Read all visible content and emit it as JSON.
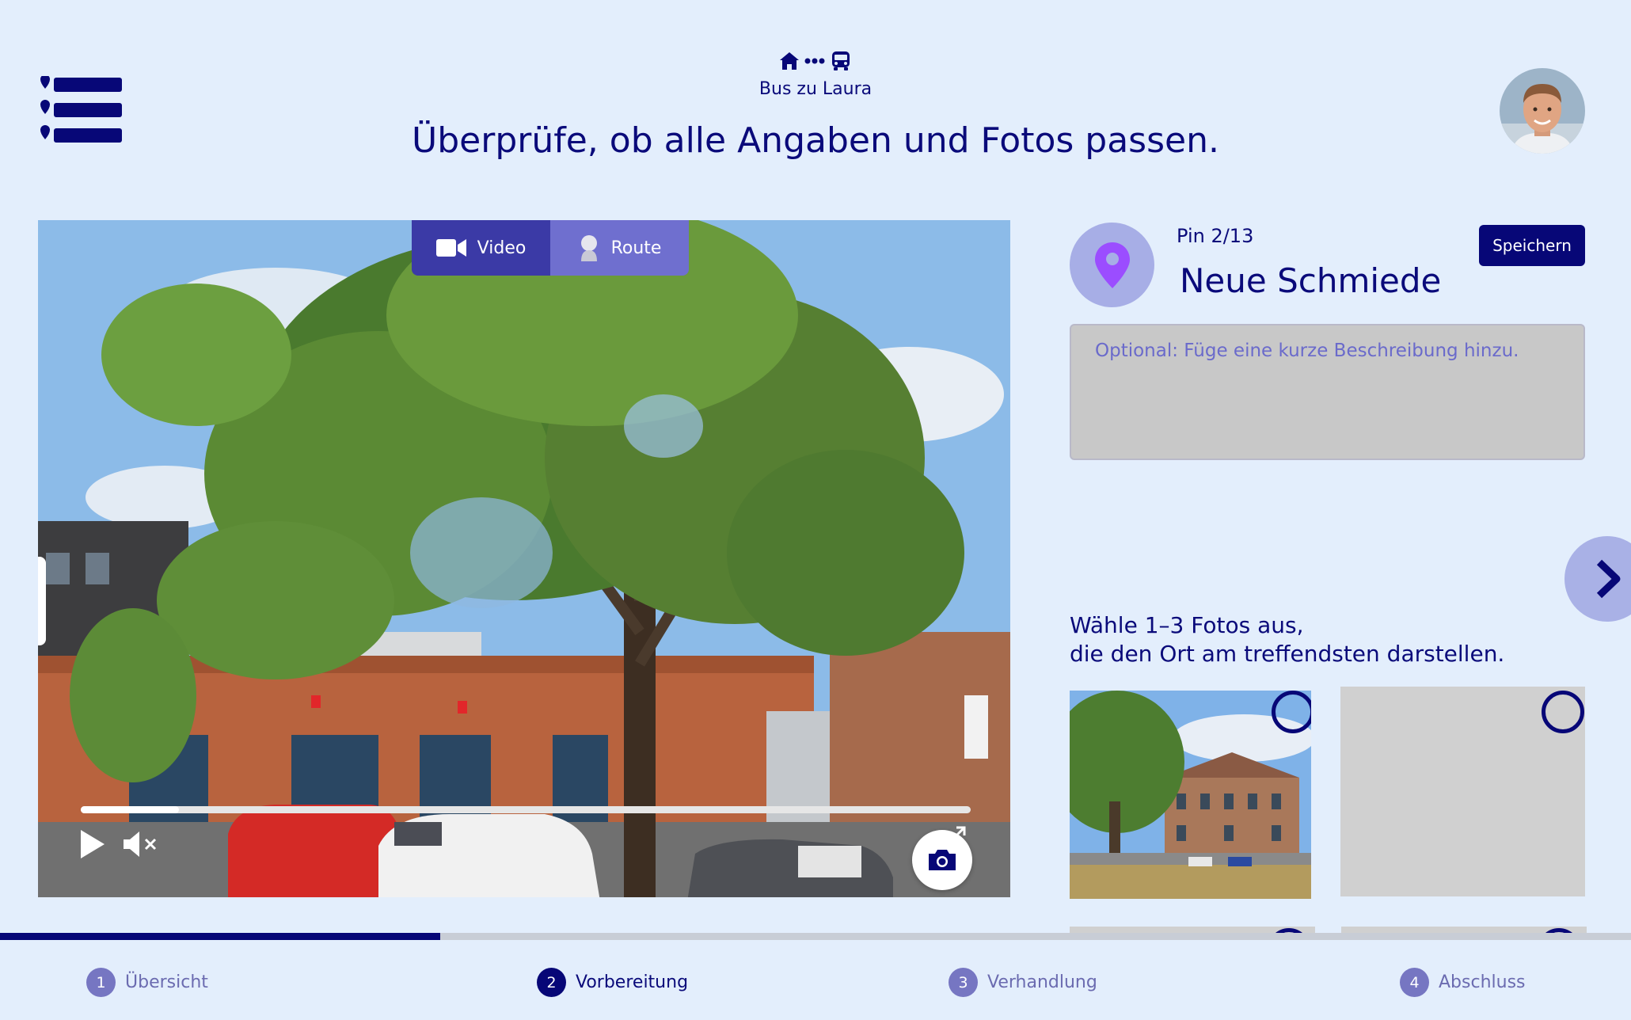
{
  "header": {
    "route_name": "Bus zu Laura",
    "title": "Überprüfe, ob alle Angaben und Fotos passen.",
    "route_icons": [
      "home-icon",
      "dots-icon",
      "bus-icon"
    ]
  },
  "media": {
    "tabs": [
      {
        "label": "Video",
        "icon": "video-camera-icon",
        "active": true
      },
      {
        "label": "Route",
        "icon": "person-icon",
        "active": false
      }
    ],
    "video_progress": 0.11
  },
  "pin": {
    "counter": "Pin 2/13",
    "name": "Neue Schmiede",
    "save_label": "Speichern",
    "description_placeholder": "Optional: Füge eine kurze Beschreibung hinzu."
  },
  "photos": {
    "prompt_line1": "Wähle 1–3 Fotos aus,",
    "prompt_line2": "die den Ort am treffendsten darstellen."
  },
  "steps": [
    {
      "number": "1",
      "label": "Übersicht",
      "active": false
    },
    {
      "number": "2",
      "label": "Vorbereitung",
      "active": true
    },
    {
      "number": "3",
      "label": "Verhandlung",
      "active": false
    },
    {
      "number": "4",
      "label": "Abschluss",
      "active": false
    }
  ],
  "step_progress": 0.27,
  "colors": {
    "background": "#e3eefc",
    "primary": "#070777",
    "accent": "#9b4dff",
    "tab_active": "#3b3aa6",
    "tab_inactive": "#6f6fcf"
  }
}
